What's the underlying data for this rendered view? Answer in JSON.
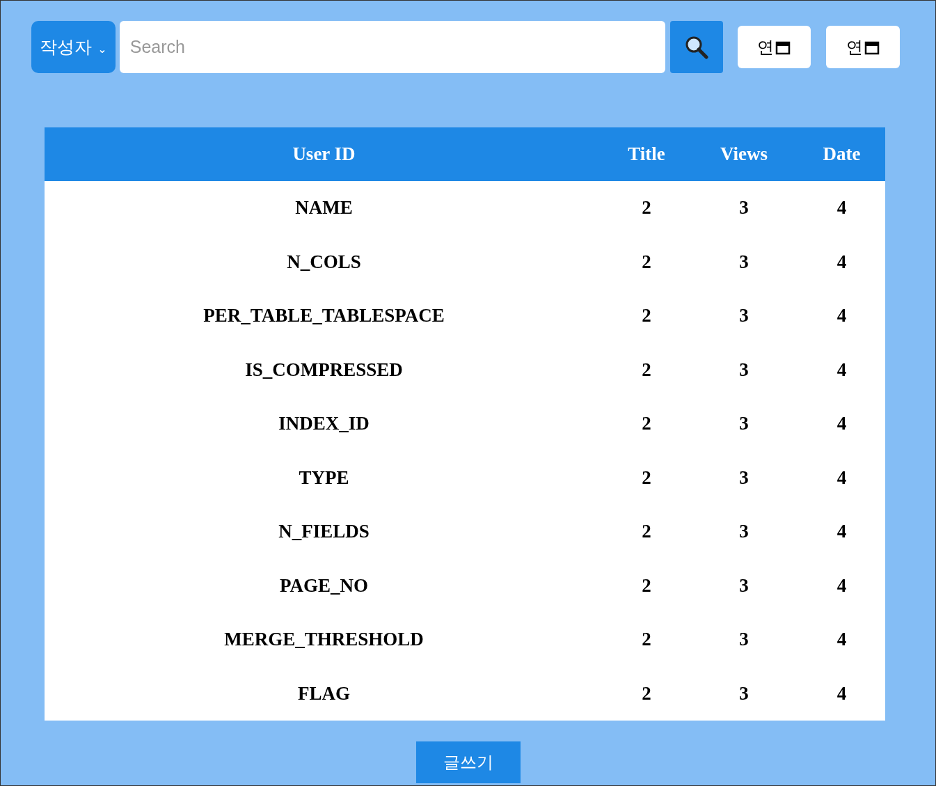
{
  "search_bar": {
    "filter": {
      "label": "작성자",
      "caret": "⌄"
    },
    "placeholder": "Search",
    "date_fields": [
      {
        "value": "연"
      },
      {
        "value": "연"
      }
    ]
  },
  "table": {
    "columns": [
      "User ID",
      "Title",
      "Views",
      "Date"
    ],
    "rows": [
      [
        "NAME",
        "2",
        "3",
        "4"
      ],
      [
        "N_COLS",
        "2",
        "3",
        "4"
      ],
      [
        "PER_TABLE_TABLESPACE",
        "2",
        "3",
        "4"
      ],
      [
        "IS_COMPRESSED",
        "2",
        "3",
        "4"
      ],
      [
        "INDEX_ID",
        "2",
        "3",
        "4"
      ],
      [
        "TYPE",
        "2",
        "3",
        "4"
      ],
      [
        "N_FIELDS",
        "2",
        "3",
        "4"
      ],
      [
        "PAGE_NO",
        "2",
        "3",
        "4"
      ],
      [
        "MERGE_THRESHOLD",
        "2",
        "3",
        "4"
      ],
      [
        "FLAG",
        "2",
        "3",
        "4"
      ]
    ]
  },
  "write_button": "글쓰기"
}
